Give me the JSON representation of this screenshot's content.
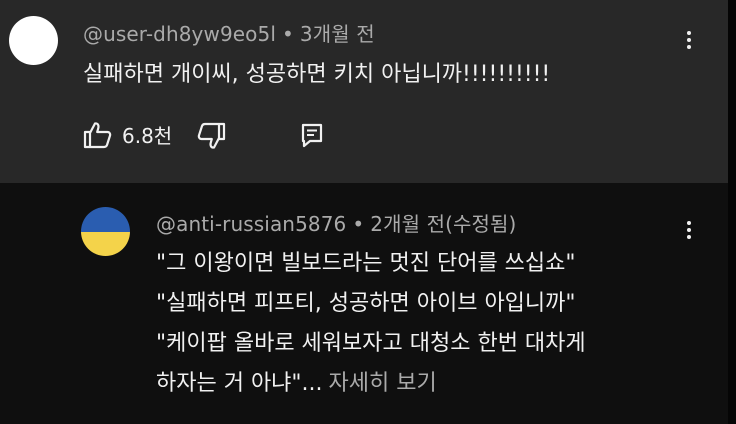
{
  "colors": {
    "top_comment_bg": "#282828",
    "page_bg": "#0f0f0f",
    "text_primary": "#f1f1f1",
    "text_secondary": "#aaaaaa",
    "flag_blue": "#2a5db0",
    "flag_yellow": "#f4d34a"
  },
  "comment": {
    "username": "@user-dh8yw9eo5l",
    "separator": "•",
    "time": "3개월 전",
    "text": "실패하면 개이씨, 성공하면 키치 아닙니까!!!!!!!!!!",
    "like_count": "6.8천",
    "icons": {
      "like": "thumbs-up-icon",
      "dislike": "thumbs-down-icon",
      "reply": "reply-comment-icon",
      "menu": "more-vert-icon"
    }
  },
  "reply": {
    "username": "@anti-russian5876",
    "separator": "•",
    "time": "2개월 전(수정됨)",
    "lines": [
      "\"그 이왕이면 빌보드라는 멋진 단어를 쓰십쇼\"",
      "\"실패하면 피프티, 성공하면 아이브 아입니까\"",
      "\"케이팝 올바로 세워보자고 대청소 한번 대차게",
      "하자는 거 아냐\"..."
    ],
    "read_more": "자세히 보기",
    "icons": {
      "menu": "more-vert-icon",
      "avatar": "ukraine-flag-avatar"
    }
  }
}
